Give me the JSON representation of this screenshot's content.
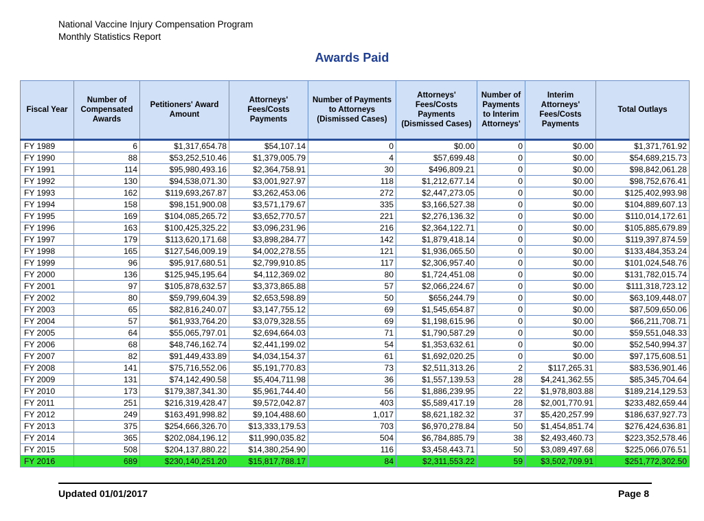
{
  "header": {
    "line1": "National Vaccine Injury Compensation Program",
    "line2": "Monthly Statistics Report"
  },
  "title": "Awards Paid",
  "table": {
    "columns": [
      "Fiscal Year",
      "Number of Compensated Awards",
      "Petitioners' Award Amount",
      "Attorneys' Fees/Costs Payments",
      "Number of Payments to Attorneys (Dismissed Cases)",
      "Attorneys' Fees/Costs Payments (Dismissed Cases)",
      "Number of Payments to Interim Attorneys'",
      "Interim Attorneys' Fees/Costs Payments",
      "Total Outlays"
    ],
    "rows": [
      [
        "FY 1989",
        "6",
        "$1,317,654.78",
        "$54,107.14",
        "0",
        "$0.00",
        "0",
        "$0.00",
        "$1,371,761.92"
      ],
      [
        "FY 1990",
        "88",
        "$53,252,510.46",
        "$1,379,005.79",
        "4",
        "$57,699.48",
        "0",
        "$0.00",
        "$54,689,215.73"
      ],
      [
        "FY 1991",
        "114",
        "$95,980,493.16",
        "$2,364,758.91",
        "30",
        "$496,809.21",
        "0",
        "$0.00",
        "$98,842,061.28"
      ],
      [
        "FY 1992",
        "130",
        "$94,538,071.30",
        "$3,001,927.97",
        "118",
        "$1,212,677.14",
        "0",
        "$0.00",
        "$98,752,676.41"
      ],
      [
        "FY 1993",
        "162",
        "$119,693,267.87",
        "$3,262,453.06",
        "272",
        "$2,447,273.05",
        "0",
        "$0.00",
        "$125,402,993.98"
      ],
      [
        "FY 1994",
        "158",
        "$98,151,900.08",
        "$3,571,179.67",
        "335",
        "$3,166,527.38",
        "0",
        "$0.00",
        "$104,889,607.13"
      ],
      [
        "FY 1995",
        "169",
        "$104,085,265.72",
        "$3,652,770.57",
        "221",
        "$2,276,136.32",
        "0",
        "$0.00",
        "$110,014,172.61"
      ],
      [
        "FY 1996",
        "163",
        "$100,425,325.22",
        "$3,096,231.96",
        "216",
        "$2,364,122.71",
        "0",
        "$0.00",
        "$105,885,679.89"
      ],
      [
        "FY 1997",
        "179",
        "$113,620,171.68",
        "$3,898,284.77",
        "142",
        "$1,879,418.14",
        "0",
        "$0.00",
        "$119,397,874.59"
      ],
      [
        "FY 1998",
        "165",
        "$127,546,009.19",
        "$4,002,278.55",
        "121",
        "$1,936,065.50",
        "0",
        "$0.00",
        "$133,484,353.24"
      ],
      [
        "FY 1999",
        "96",
        "$95,917,680.51",
        "$2,799,910.85",
        "117",
        "$2,306,957.40",
        "0",
        "$0.00",
        "$101,024,548.76"
      ],
      [
        "FY 2000",
        "136",
        "$125,945,195.64",
        "$4,112,369.02",
        "80",
        "$1,724,451.08",
        "0",
        "$0.00",
        "$131,782,015.74"
      ],
      [
        "FY 2001",
        "97",
        "$105,878,632.57",
        "$3,373,865.88",
        "57",
        "$2,066,224.67",
        "0",
        "$0.00",
        "$111,318,723.12"
      ],
      [
        "FY 2002",
        "80",
        "$59,799,604.39",
        "$2,653,598.89",
        "50",
        "$656,244.79",
        "0",
        "$0.00",
        "$63,109,448.07"
      ],
      [
        "FY 2003",
        "65",
        "$82,816,240.07",
        "$3,147,755.12",
        "69",
        "$1,545,654.87",
        "0",
        "$0.00",
        "$87,509,650.06"
      ],
      [
        "FY 2004",
        "57",
        "$61,933,764.20",
        "$3,079,328.55",
        "69",
        "$1,198,615.96",
        "0",
        "$0.00",
        "$66,211,708.71"
      ],
      [
        "FY 2005",
        "64",
        "$55,065,797.01",
        "$2,694,664.03",
        "71",
        "$1,790,587.29",
        "0",
        "$0.00",
        "$59,551,048.33"
      ],
      [
        "FY 2006",
        "68",
        "$48,746,162.74",
        "$2,441,199.02",
        "54",
        "$1,353,632.61",
        "0",
        "$0.00",
        "$52,540,994.37"
      ],
      [
        "FY 2007",
        "82",
        "$91,449,433.89",
        "$4,034,154.37",
        "61",
        "$1,692,020.25",
        "0",
        "$0.00",
        "$97,175,608.51"
      ],
      [
        "FY 2008",
        "141",
        "$75,716,552.06",
        "$5,191,770.83",
        "73",
        "$2,511,313.26",
        "2",
        "$117,265.31",
        "$83,536,901.46"
      ],
      [
        "FY 2009",
        "131",
        "$74,142,490.58",
        "$5,404,711.98",
        "36",
        "$1,557,139.53",
        "28",
        "$4,241,362.55",
        "$85,345,704.64"
      ],
      [
        "FY 2010",
        "173",
        "$179,387,341.30",
        "$5,961,744.40",
        "56",
        "$1,886,239.95",
        "22",
        "$1,978,803.88",
        "$189,214,129.53"
      ],
      [
        "FY 2011",
        "251",
        "$216,319,428.47",
        "$9,572,042.87",
        "403",
        "$5,589,417.19",
        "28",
        "$2,001,770.91",
        "$233,482,659.44"
      ],
      [
        "FY 2012",
        "249",
        "$163,491,998.82",
        "$9,104,488.60",
        "1,017",
        "$8,621,182.32",
        "37",
        "$5,420,257.99",
        "$186,637,927.73"
      ],
      [
        "FY 2013",
        "375",
        "$254,666,326.70",
        "$13,333,179.53",
        "703",
        "$6,970,278.84",
        "50",
        "$1,454,851.74",
        "$276,424,636.81"
      ],
      [
        "FY 2014",
        "365",
        "$202,084,196.12",
        "$11,990,035.82",
        "504",
        "$6,784,885.79",
        "38",
        "$2,493,460.73",
        "$223,352,578.46"
      ],
      [
        "FY 2015",
        "508",
        "$204,137,880.22",
        "$14,380,254.90",
        "116",
        "$3,458,443.71",
        "50",
        "$3,089,497.68",
        "$225,066,076.51"
      ],
      [
        "FY 2016",
        "689",
        "$230,140,251.20",
        "$15,817,788.17",
        "84",
        "$2,311,553.22",
        "59",
        "$3,502,709.91",
        "$251,772,302.50"
      ]
    ],
    "highlight_row": 27,
    "highlight_color": "#33e833",
    "header_color": "#cfe0f7",
    "border_color": "#6a8fc8"
  },
  "footer": {
    "updated": "Updated 01/01/2017",
    "page": "Page 8"
  },
  "colors": {
    "title": "#1f3f95"
  }
}
